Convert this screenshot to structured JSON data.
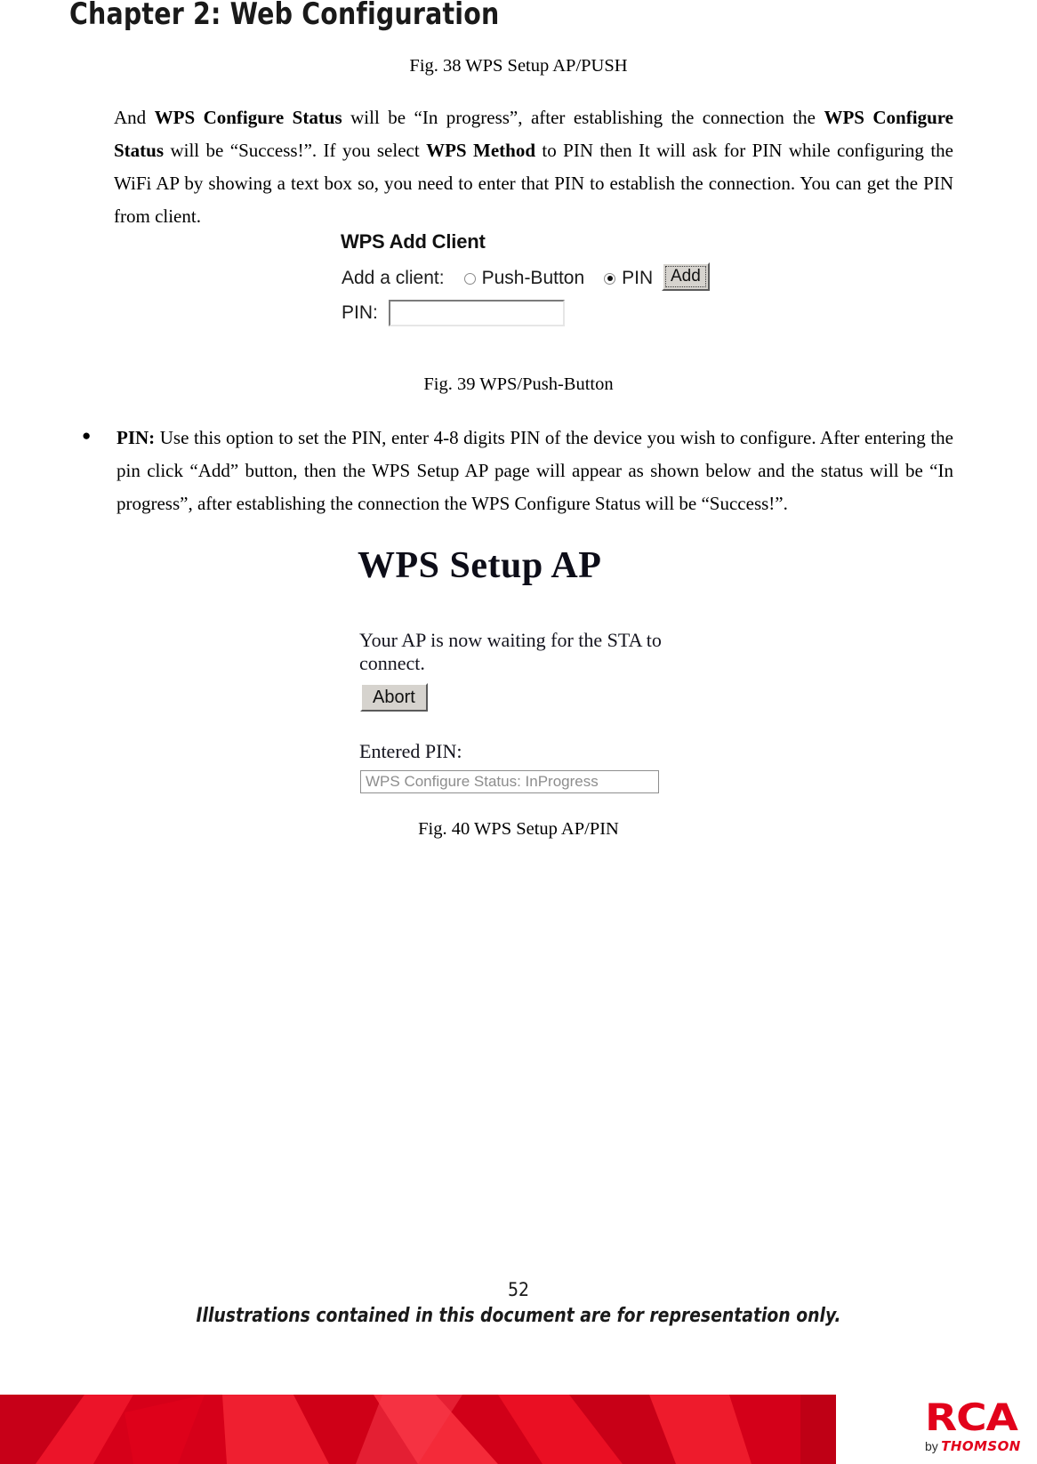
{
  "header": {
    "chapter_title": "Chapter 2: Web Configuration"
  },
  "captions": {
    "fig38": "Fig. 38 WPS Setup AP/PUSH",
    "fig39": "Fig. 39 WPS/Push-Button",
    "fig40": "Fig. 40 WPS Setup AP/PIN"
  },
  "paragraphs": {
    "intro": {
      "p1": "And ",
      "b1": "WPS Configure Status",
      "p2": " will be “In progress”, after establishing the connection the ",
      "b2": "WPS Configure Status",
      "p3": " will be “Success!”. If you select ",
      "b3": "WPS Method",
      "p4": " to PIN then It will ask for PIN while configuring the WiFi AP by showing a text box so, you need to enter that PIN to establish the connection. You can get the PIN from client."
    },
    "pin_bullet": {
      "marker": "●",
      "label": "PIN:",
      "text": " Use this option to set the PIN, enter 4-8 digits PIN of the device you wish to configure. After entering the pin click “Add” button, then the WPS Setup AP page will appear as shown below and the status will be “In progress”, after establishing the connection the WPS Configure Status will be “Success!”."
    }
  },
  "wps_add_client": {
    "title": "WPS Add Client",
    "add_client_label": "Add a client:",
    "option_push_button": "Push-Button",
    "option_pin": "PIN",
    "selected_option": "PIN",
    "add_button": "Add",
    "pin_label": "PIN:",
    "pin_value": "",
    "pin_placeholder": ""
  },
  "wps_setup_ap": {
    "title": "WPS Setup AP",
    "status_line": "Your AP is now waiting for the STA to connect.",
    "abort_button": "Abort",
    "entered_pin_label": "Entered PIN:",
    "entered_pin_value": "",
    "configure_status": "WPS Configure Status: InProgress"
  },
  "footer": {
    "page_number": "52",
    "note": "Illustrations contained in this document are for representation only."
  },
  "logo": {
    "brand": "RCA",
    "by_text": "by",
    "partner": "THOMSON"
  },
  "colors": {
    "brand_red": "#e2021b",
    "banner_red_dark": "#c10016",
    "status_text_gray": "#8d8d8d",
    "button_face": "#d6d3ce"
  }
}
